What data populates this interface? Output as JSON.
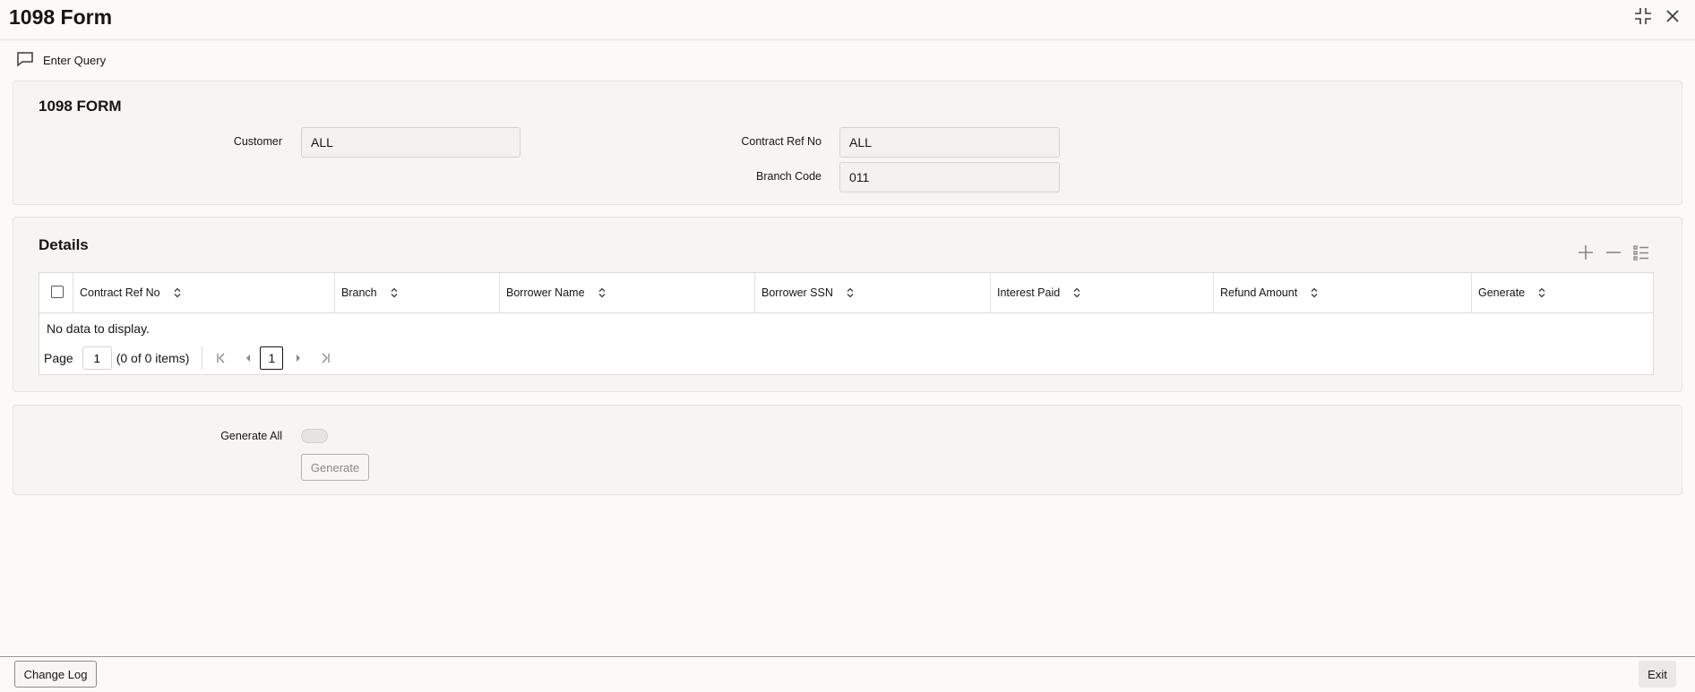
{
  "window": {
    "title": "1098 Form"
  },
  "toolbar": {
    "enter_query_label": "Enter Query"
  },
  "form": {
    "heading": "1098 FORM",
    "customer_label": "Customer",
    "customer_value": "ALL",
    "contract_ref_label": "Contract Ref No",
    "contract_ref_value": "ALL",
    "branch_code_label": "Branch Code",
    "branch_code_value": "011"
  },
  "details": {
    "heading": "Details",
    "columns": [
      "Contract Ref No",
      "Branch",
      "Borrower Name",
      "Borrower SSN",
      "Interest Paid",
      "Refund Amount",
      "Generate"
    ],
    "empty_message": "No data to display.",
    "pager": {
      "page_label": "Page",
      "page_value": "1",
      "items_text": "(0 of 0 items)",
      "current_page": "1"
    }
  },
  "generate": {
    "generate_all_label": "Generate All",
    "generate_all_on": false,
    "generate_button_label": "Generate"
  },
  "footer": {
    "change_log_label": "Change Log",
    "exit_label": "Exit"
  },
  "icons": [
    "chat-icon",
    "collapse-icon",
    "close-icon",
    "add-row-icon",
    "delete-row-icon",
    "column-list-icon",
    "sort-icon",
    "first-page-icon",
    "prev-page-icon",
    "next-page-icon",
    "last-page-icon"
  ]
}
